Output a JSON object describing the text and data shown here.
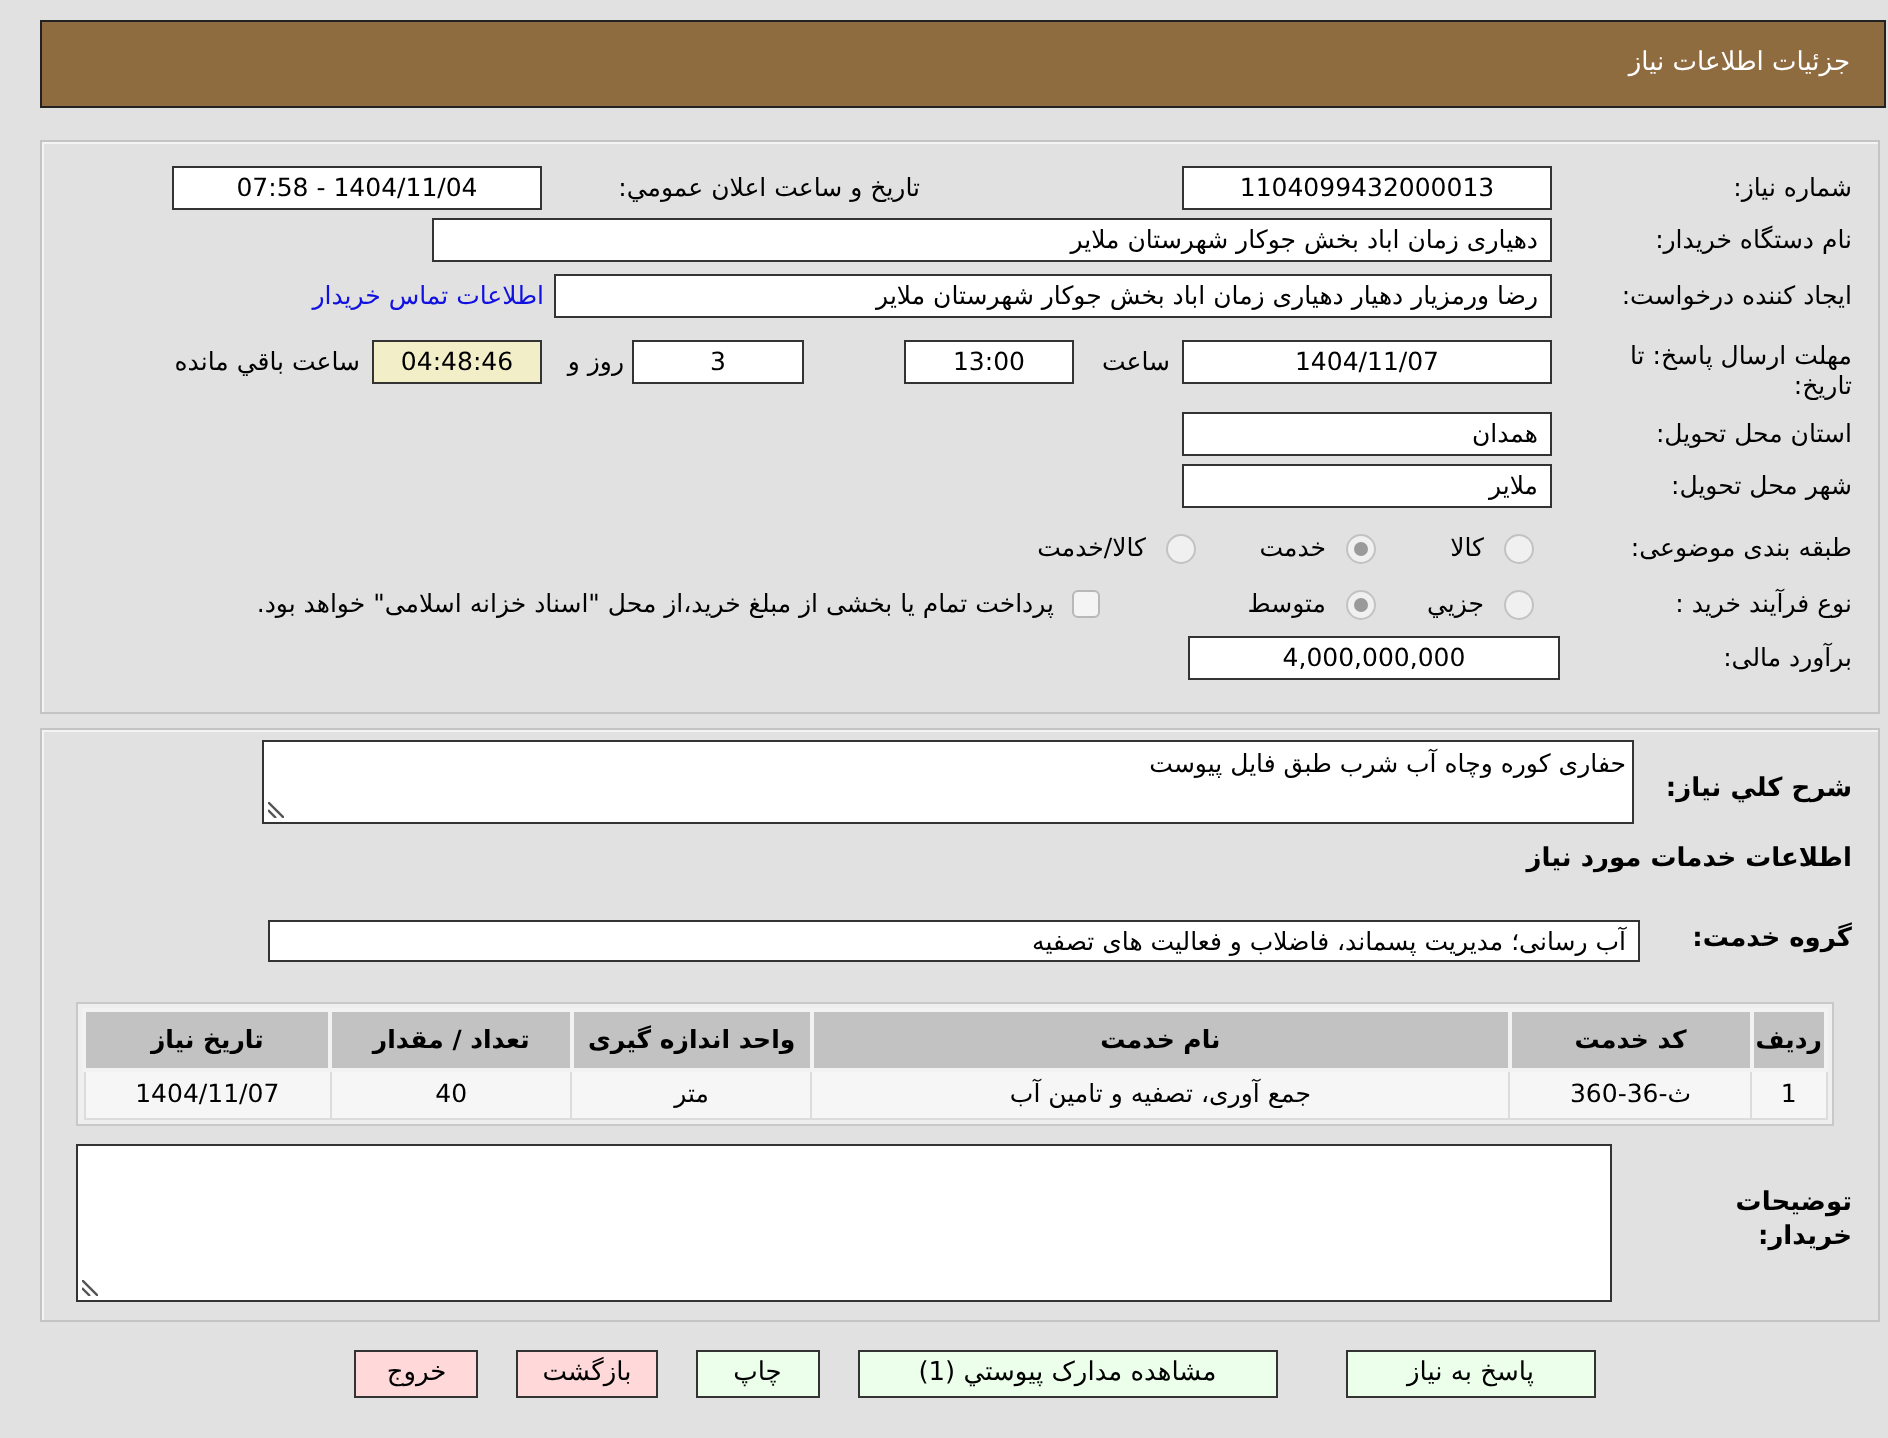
{
  "header": {
    "title": "جزئیات اطلاعات نیاز"
  },
  "details": {
    "need_number": {
      "label": "شماره نیاز:",
      "value": "1104099432000013"
    },
    "announce_datetime": {
      "label": "تاریخ و ساعت اعلان عمومي:",
      "value": "1404/11/04 - 07:58"
    },
    "buyer_org": {
      "label": "نام دستگاه خریدار:",
      "value": "دهیاری زمان اباد بخش جوکار شهرستان ملایر"
    },
    "requester": {
      "label": "ایجاد کننده درخواست:",
      "value": "رضا ورمزیار دهیار دهیاری زمان اباد بخش جوکار شهرستان ملایر",
      "link": "اطلاعات تماس خریدار"
    },
    "deadline": {
      "label": "مهلت ارسال پاسخ: تا تاریخ:",
      "date": "1404/11/07",
      "time_label": "ساعت",
      "time": "13:00",
      "days": "3",
      "days_label": "روز و",
      "remaining": "04:48:46",
      "remaining_label": "ساعت باقي مانده"
    },
    "province": {
      "label": "استان محل تحویل:",
      "value": "همدان"
    },
    "city": {
      "label": "شهر محل تحویل:",
      "value": "ملایر"
    },
    "category": {
      "label": "طبقه بندی موضوعی:",
      "options": [
        {
          "label": "کالا",
          "selected": false
        },
        {
          "label": "خدمت",
          "selected": true
        },
        {
          "label": "کالا/خدمت",
          "selected": false
        }
      ]
    },
    "purchase_type": {
      "label": "نوع فرآیند خرید :",
      "options": [
        {
          "label": "جزيي",
          "selected": false
        },
        {
          "label": "متوسط",
          "selected": true
        }
      ],
      "treasury_option": {
        "label": "پرداخت تمام یا بخشی از مبلغ خرید،از محل \"اسناد خزانه اسلامی\" خواهد بود.",
        "checked": false
      }
    },
    "budget": {
      "label": "برآورد مالی:",
      "value": "4,000,000,000"
    }
  },
  "description": {
    "label": "شرح کلي نیاز:",
    "value": "حفاری کوره وچاه آب شرب طبق فایل پیوست"
  },
  "services": {
    "title": "اطلاعات خدمات مورد نیاز",
    "group": {
      "label": "گروه خدمت:",
      "value": "آب رسانی؛ مدیریت پسماند، فاضلاب و فعالیت های تصفیه"
    },
    "table": {
      "columns": [
        "ردیف",
        "کد خدمت",
        "نام خدمت",
        "واحد اندازه گیری",
        "تعداد / مقدار",
        "تاریخ نیاز"
      ],
      "rows": [
        [
          "1",
          "ث-36-360",
          "جمع آوری، تصفیه و تامین آب",
          "متر",
          "40",
          "1404/11/07"
        ]
      ]
    }
  },
  "buyer_notes": {
    "label": "توضیحات خریدار:"
  },
  "buttons": [
    {
      "label": "پاسخ به نیاز",
      "kind": "normal"
    },
    {
      "label": "مشاهده مدارک پیوستي (1)",
      "kind": "normal"
    },
    {
      "label": "چاپ",
      "kind": "normal"
    },
    {
      "label": "بازگشت",
      "kind": "cancel"
    },
    {
      "label": "خروج",
      "kind": "cancel"
    }
  ]
}
